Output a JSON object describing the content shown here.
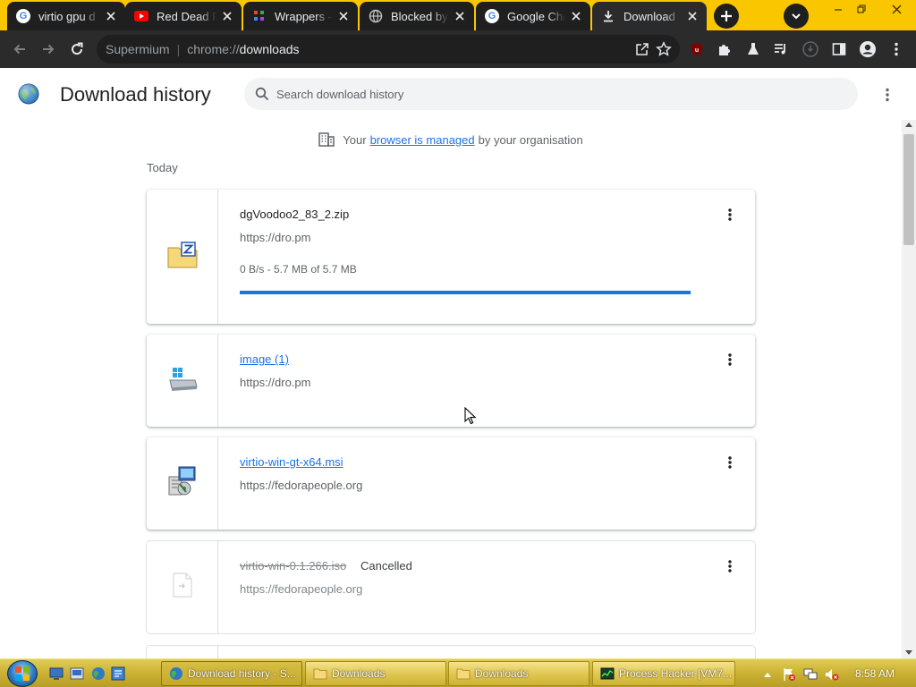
{
  "tabs": [
    {
      "title": "virtio gpu d",
      "icon": "google-icon",
      "active": false
    },
    {
      "title": "Red Dead R",
      "icon": "youtube-icon",
      "active": false
    },
    {
      "title": "Wrappers –",
      "icon": "wrappers-icon",
      "active": false
    },
    {
      "title": "Blocked by",
      "icon": "globe-icon",
      "active": false
    },
    {
      "title": "Google Chr",
      "icon": "google-icon",
      "active": false
    },
    {
      "title": "Download",
      "icon": "download-icon",
      "active": true
    }
  ],
  "omnibox": {
    "site_name": "Supermium",
    "url_scheme": "chrome://",
    "url_path": "downloads"
  },
  "page": {
    "title": "Download history",
    "search_placeholder": "Search download history",
    "managed_prefix": "Your",
    "managed_link": "browser is managed",
    "managed_suffix": "by your organisation",
    "date_label": "Today"
  },
  "downloads": [
    {
      "filename": "dgVoodoo2_83_2.zip",
      "url": "https://dro.pm",
      "progress_text": "0 B/s - 5.7 MB of 5.7 MB",
      "progress": 1.0,
      "icon": "zip-archive-icon"
    },
    {
      "filename": "image (1)",
      "url": "https://dro.pm",
      "icon": "disk-image-icon"
    },
    {
      "filename": "virtio-win-gt-x64.msi",
      "url": "https://fedorapeople.org",
      "icon": "installer-icon"
    },
    {
      "filename": "virtio-win-0.1.266.iso",
      "status": "Cancelled",
      "url": "https://fedorapeople.org",
      "icon": "generic-file-icon"
    }
  ],
  "taskbar": {
    "buttons": [
      {
        "label": "Download history - S...",
        "icon": "chrome-icon",
        "active": true
      },
      {
        "label": "Downloads",
        "icon": "folder-icon",
        "active": false
      },
      {
        "label": "Downloads",
        "icon": "folder-icon",
        "active": false
      },
      {
        "label": "Process Hacker [VM7...",
        "icon": "process-hacker-icon",
        "active": false
      }
    ],
    "clock": "8:58 AM"
  },
  "colors": {
    "tab_strip": "#f9c600",
    "toolbar": "#2b2b2b",
    "link": "#1a73e8",
    "progress": "#1a73e8"
  }
}
